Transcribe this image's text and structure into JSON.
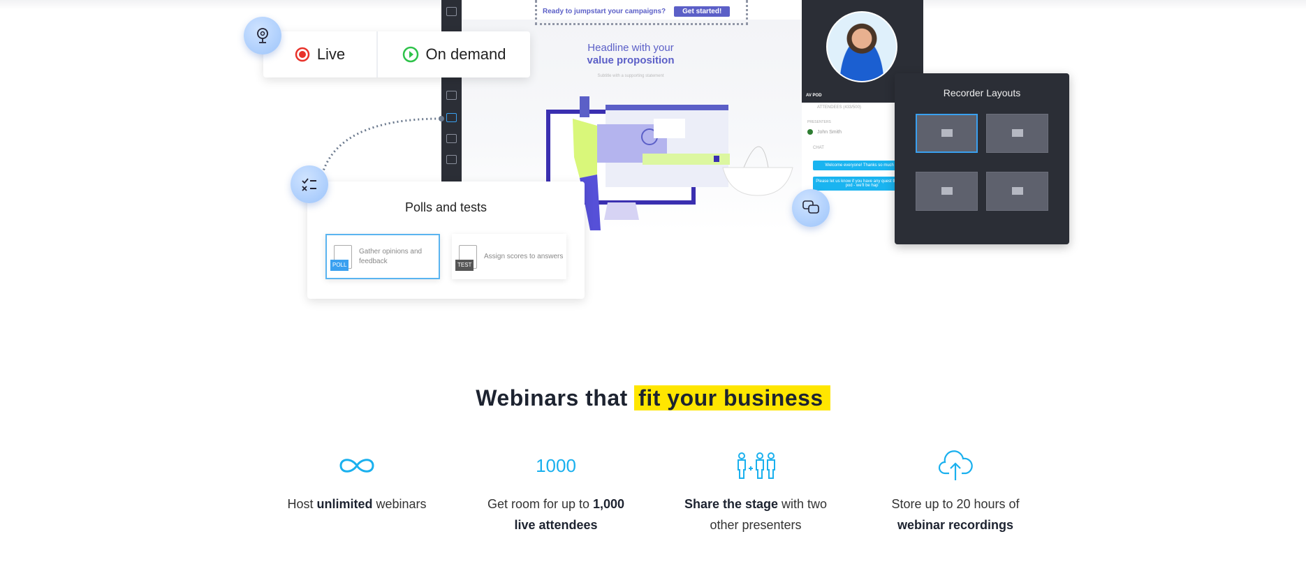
{
  "hero": {
    "banner": {
      "text": "Ready to jumpstart your campaigns?",
      "button": "Get started!"
    },
    "headline": {
      "line1": "Headline with your",
      "line2": "value proposition",
      "subtitle": "Subtitle with a supporting statement"
    },
    "broadcast": {
      "live": "Live",
      "on_demand": "On demand"
    },
    "polls": {
      "title": "Polls and tests",
      "poll_badge": "POLL",
      "poll_text": "Gather opinions and feedback",
      "test_badge": "TEST",
      "test_text": "Assign scores to answers"
    },
    "presenter": {
      "pod_label": "AV POD",
      "attendees": "ATTENDEES (433/500)",
      "presenters": "PRESENTERS",
      "name": "John Smith",
      "chat": "CHAT",
      "msg1": "Welcome everyone! Thanks so much fo",
      "msg2": "Please let us know if you have any quest the chat pod - we'll be hap"
    },
    "recorder": {
      "title": "Recorder Layouts"
    }
  },
  "section": {
    "heading_plain": "Webinars that",
    "heading_highlight": "fit your business",
    "highlight_color": "#ffe600",
    "accent_color": "#1ab0ee",
    "features": [
      {
        "icon": "infinity-icon",
        "pre": "Host ",
        "bold": "unlimited",
        "post": " webinars",
        "line2_pre": "",
        "line2_bold": "",
        "line2_post": ""
      },
      {
        "icon_text": "1000",
        "pre": "Get room for up to ",
        "bold": "1,000",
        "post": "",
        "line2_pre": "",
        "line2_bold": "live attendees",
        "line2_post": ""
      },
      {
        "icon": "presenters-icon",
        "pre": "",
        "bold": "Share the stage",
        "post": " with two",
        "line2_pre": "other presenters",
        "line2_bold": "",
        "line2_post": ""
      },
      {
        "icon": "cloud-upload-icon",
        "pre": "Store up to 20 hours of",
        "bold": "",
        "post": "",
        "line2_pre": "",
        "line2_bold": "webinar recordings",
        "line2_post": ""
      }
    ]
  }
}
